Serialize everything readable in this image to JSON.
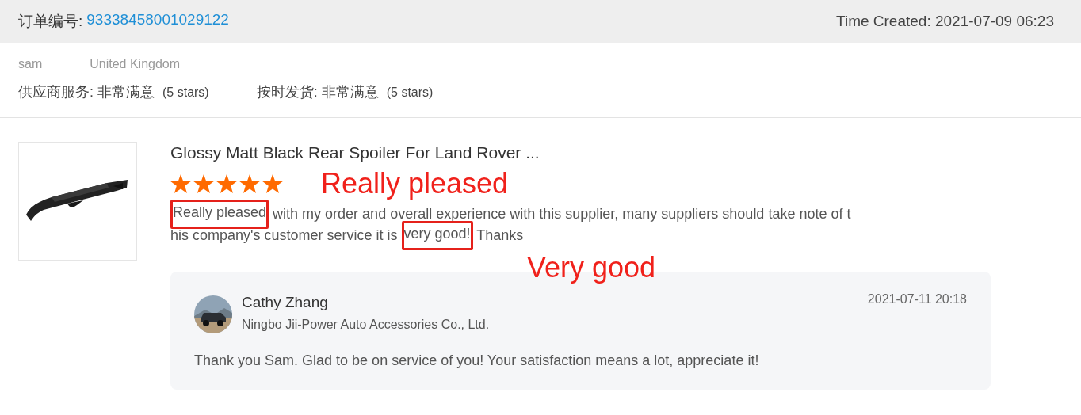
{
  "header": {
    "order_label": "订单编号:",
    "order_number": "93338458001029122",
    "time_created": "Time Created: 2021-07-09 06:23"
  },
  "buyer": {
    "name": "sam",
    "country": "United Kingdom"
  },
  "ratings": [
    {
      "label": "供应商服务:",
      "value": "非常满意",
      "stars_text": "(5 stars)"
    },
    {
      "label": "按时发货:",
      "value": "非常满意",
      "stars_text": "(5 stars)"
    }
  ],
  "review": {
    "product_image": {
      "kind": "picture"
    },
    "product_title": "Glossy Matt Black Rear Spoiler For Land Rover ...",
    "stars": 5,
    "comment_lines": [
      [
        {
          "text": "Really pleased",
          "highlighted": true
        },
        {
          "text": " with my order and overall experience with this supplier, many suppliers should take note of t",
          "highlighted": false
        }
      ],
      [
        {
          "text": "his company's customer service it is ",
          "highlighted": false
        },
        {
          "text": "very good!",
          "highlighted": true
        },
        {
          "text": " Thanks",
          "highlighted": false
        }
      ]
    ]
  },
  "annotations": [
    {
      "text": "Really pleased"
    },
    {
      "text": "Very good"
    }
  ],
  "reply": {
    "name": "Cathy Zhang",
    "company": "Ningbo Jii-Power Auto Accessories Co., Ltd.",
    "time": "2021-07-11 20:18",
    "message": "Thank you Sam. Glad to be on service of you! Your satisfaction means a lot, appreciate it!"
  }
}
